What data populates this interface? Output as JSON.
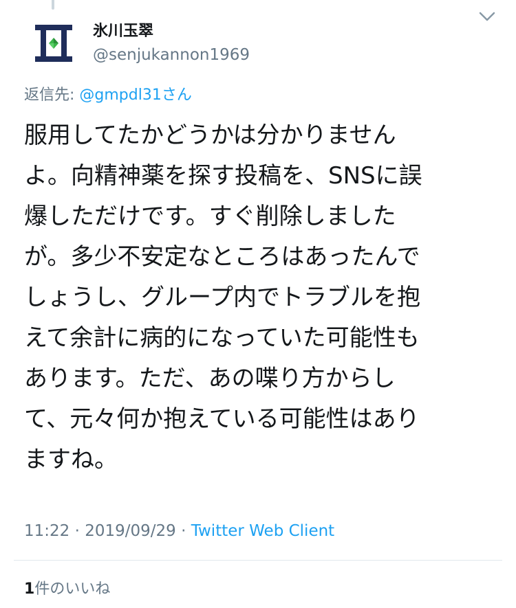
{
  "author": {
    "display_name": "氷川玉翠",
    "handle": "@senjukannon1969",
    "avatar_icon": "hourglass-emblem-icon"
  },
  "reply": {
    "prefix": "返信先: ",
    "mention": "@gmpdl31",
    "suffix": "さん"
  },
  "tweet": {
    "lines": [
      "服用してたかどうかは分かりません",
      "よ。向精神薬を探す投稿を、SNSに誤",
      "爆しただけです。すぐ削除しました",
      "が。多少不安定なところはあったんで",
      "しょうし、グループ内でトラブルを抱",
      "えて余計に病的になっていた可能性も",
      "あります。ただ、あの喋り方からし",
      "て、元々何か抱えている可能性はあり",
      "ますね。"
    ]
  },
  "meta": {
    "time": "11:22",
    "separator": " · ",
    "date": "2019/09/29",
    "client": "Twitter Web Client"
  },
  "likes": {
    "count": "1",
    "label": "件のいいね"
  },
  "colors": {
    "text": "#14171a",
    "secondary": "#657786",
    "link": "#1da1f2",
    "divider": "#e1e8ed",
    "avatar_navy": "#1f2d5a",
    "avatar_gem": "#3bb54a"
  },
  "icons": {
    "menu": "chevron-down-icon"
  }
}
